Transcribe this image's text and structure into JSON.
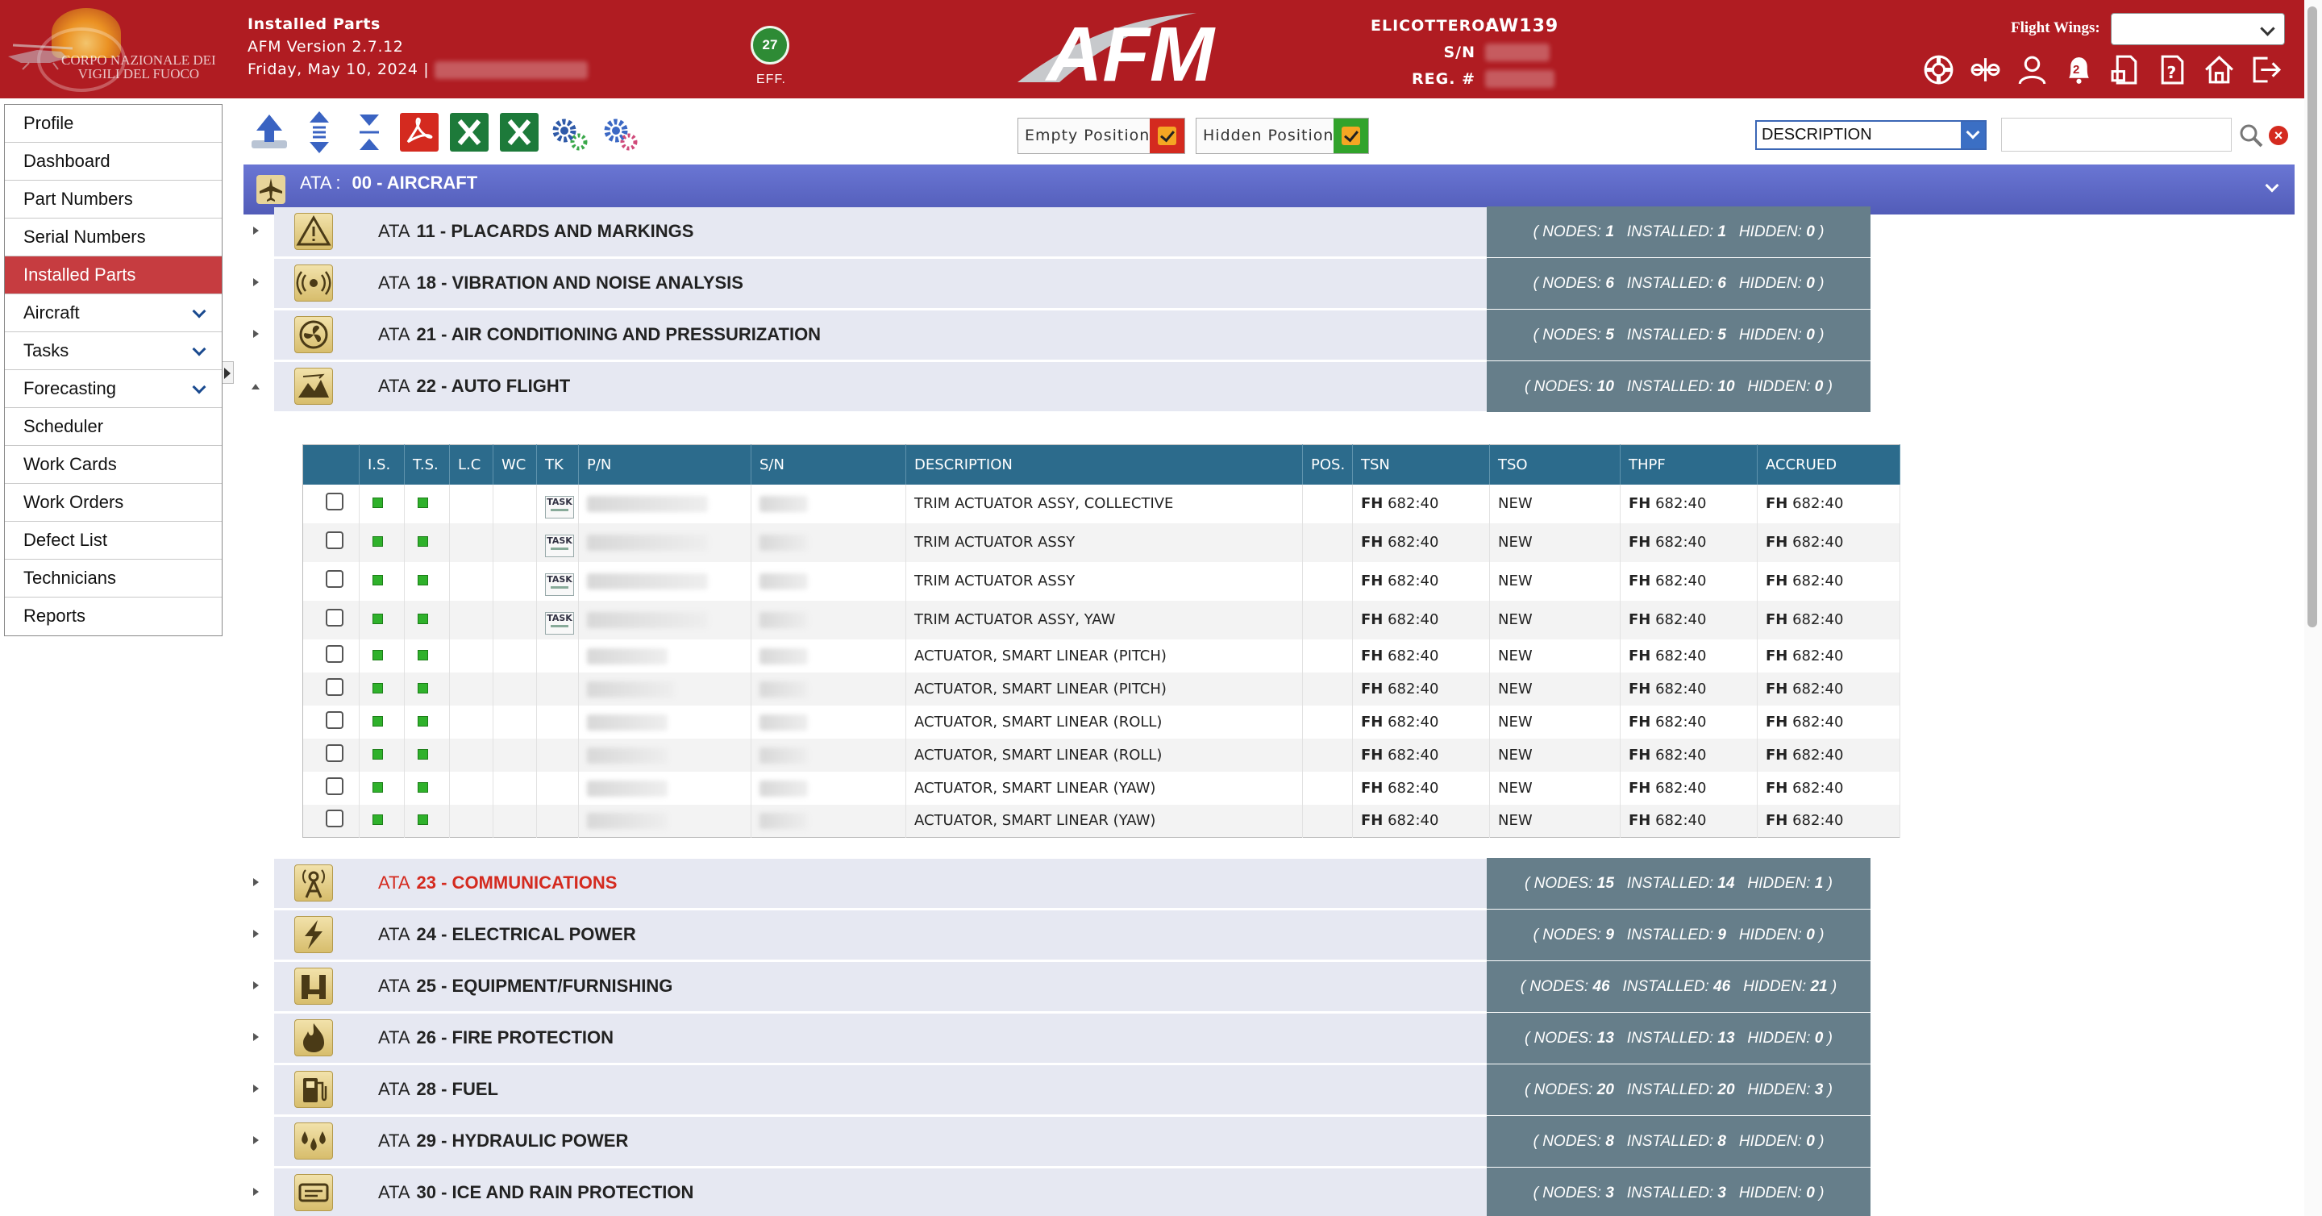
{
  "header": {
    "logo_text": [
      "CORPO NAZIONALE dei",
      "VIGILI DEL FUOCO"
    ],
    "page_title": "Installed Parts",
    "version": "AFM Version 2.7.12",
    "date": "Friday, May 10, 2024 |",
    "eff_count": "27",
    "eff_label": "EFF.",
    "brand": "AFM",
    "heli_label": "ELICOTTERO:",
    "heli_model": "AW139",
    "sn_label": "S/N",
    "reg_label": "REG. #",
    "flight_wings_label": "Flight Wings:",
    "notification_count": "2"
  },
  "sidebar": {
    "items": [
      {
        "label": "Profile",
        "active": false,
        "expandable": false
      },
      {
        "label": "Dashboard",
        "active": false,
        "expandable": false
      },
      {
        "label": "Part Numbers",
        "active": false,
        "expandable": false
      },
      {
        "label": "Serial Numbers",
        "active": false,
        "expandable": false
      },
      {
        "label": "Installed Parts",
        "active": true,
        "expandable": false
      },
      {
        "label": "Aircraft",
        "active": false,
        "expandable": true
      },
      {
        "label": "Tasks",
        "active": false,
        "expandable": true
      },
      {
        "label": "Forecasting",
        "active": false,
        "expandable": true
      },
      {
        "label": "Scheduler",
        "active": false,
        "expandable": false
      },
      {
        "label": "Work Cards",
        "active": false,
        "expandable": false
      },
      {
        "label": "Work Orders",
        "active": false,
        "expandable": false
      },
      {
        "label": "Defect List",
        "active": false,
        "expandable": false
      },
      {
        "label": "Technicians",
        "active": false,
        "expandable": false
      },
      {
        "label": "Reports",
        "active": false,
        "expandable": false
      }
    ]
  },
  "toolbar": {
    "empty_position_label": "Empty Position",
    "hidden_position_label": "Hidden Position",
    "search_field_value": "DESCRIPTION",
    "search_input_value": ""
  },
  "root_ata": {
    "prefix": "ATA :",
    "name": "00 - AIRCRAFT"
  },
  "stats_labels": {
    "nodes": "NODES:",
    "installed": "INSTALLED:",
    "hidden": "HIDDEN:"
  },
  "ata_groups": [
    {
      "code": "11 - PLACARDS AND MARKINGS",
      "icon": "warning-icon",
      "nodes": "1",
      "installed": "1",
      "hidden": "0",
      "expanded": false,
      "alert": false
    },
    {
      "code": "18 - VIBRATION AND NOISE ANALYSIS",
      "icon": "vibration-icon",
      "nodes": "6",
      "installed": "6",
      "hidden": "0",
      "expanded": false,
      "alert": false
    },
    {
      "code": "21 - AIR CONDITIONING AND PRESSURIZATION",
      "icon": "fan-icon",
      "nodes": "5",
      "installed": "5",
      "hidden": "0",
      "expanded": false,
      "alert": false
    },
    {
      "code": "22 - AUTO FLIGHT",
      "icon": "mountain-flight-icon",
      "nodes": "10",
      "installed": "10",
      "hidden": "0",
      "expanded": true,
      "alert": false
    },
    {
      "code": "23 - COMMUNICATIONS",
      "icon": "antenna-icon",
      "nodes": "15",
      "installed": "14",
      "hidden": "1",
      "expanded": false,
      "alert": true
    },
    {
      "code": "24 - ELECTRICAL POWER",
      "icon": "lightning-icon",
      "nodes": "9",
      "installed": "9",
      "hidden": "0",
      "expanded": false,
      "alert": false
    },
    {
      "code": "25 - EQUIPMENT/FURNISHING",
      "icon": "seat-icon",
      "nodes": "46",
      "installed": "46",
      "hidden": "21",
      "expanded": false,
      "alert": false
    },
    {
      "code": "26 - FIRE PROTECTION",
      "icon": "flame-icon",
      "nodes": "13",
      "installed": "13",
      "hidden": "0",
      "expanded": false,
      "alert": false
    },
    {
      "code": "28 - FUEL",
      "icon": "fuel-pump-icon",
      "nodes": "20",
      "installed": "20",
      "hidden": "3",
      "expanded": false,
      "alert": false
    },
    {
      "code": "29 - HYDRAULIC POWER",
      "icon": "drops-icon",
      "nodes": "8",
      "installed": "8",
      "hidden": "0",
      "expanded": false,
      "alert": false
    },
    {
      "code": "30 - ICE AND RAIN PROTECTION",
      "icon": "ice-rain-icon",
      "nodes": "3",
      "installed": "3",
      "hidden": "0",
      "expanded": false,
      "alert": false
    }
  ],
  "ata_word": "ATA",
  "parts_table": {
    "columns": [
      "I.S.",
      "T.S.",
      "L.C",
      "WC",
      "TK",
      "P/N",
      "S/N",
      "DESCRIPTION",
      "POS.",
      "TSN",
      "TSO",
      "THPF",
      "ACCRUED"
    ],
    "task_label": "TASK",
    "rows": [
      {
        "description": "TRIM ACTUATOR ASSY, COLLECTIVE",
        "task": true,
        "tsn": "682:40",
        "tso": "NEW",
        "thpf": "682:40",
        "accrued": "682:40"
      },
      {
        "description": "TRIM ACTUATOR ASSY",
        "task": true,
        "tsn": "682:40",
        "tso": "NEW",
        "thpf": "682:40",
        "accrued": "682:40"
      },
      {
        "description": "TRIM ACTUATOR ASSY",
        "task": true,
        "tsn": "682:40",
        "tso": "NEW",
        "thpf": "682:40",
        "accrued": "682:40"
      },
      {
        "description": "TRIM ACTUATOR ASSY, YAW",
        "task": true,
        "tsn": "682:40",
        "tso": "NEW",
        "thpf": "682:40",
        "accrued": "682:40"
      },
      {
        "description": "ACTUATOR, SMART LINEAR (PITCH)",
        "task": false,
        "tsn": "682:40",
        "tso": "NEW",
        "thpf": "682:40",
        "accrued": "682:40"
      },
      {
        "description": "ACTUATOR, SMART LINEAR (PITCH)",
        "task": false,
        "tsn": "682:40",
        "tso": "NEW",
        "thpf": "682:40",
        "accrued": "682:40"
      },
      {
        "description": "ACTUATOR, SMART LINEAR (ROLL)",
        "task": false,
        "tsn": "682:40",
        "tso": "NEW",
        "thpf": "682:40",
        "accrued": "682:40"
      },
      {
        "description": "ACTUATOR, SMART LINEAR (ROLL)",
        "task": false,
        "tsn": "682:40",
        "tso": "NEW",
        "thpf": "682:40",
        "accrued": "682:40"
      },
      {
        "description": "ACTUATOR, SMART LINEAR (YAW)",
        "task": false,
        "tsn": "682:40",
        "tso": "NEW",
        "thpf": "682:40",
        "accrued": "682:40"
      },
      {
        "description": "ACTUATOR, SMART LINEAR (YAW)",
        "task": false,
        "tsn": "682:40",
        "tso": "NEW",
        "thpf": "682:40",
        "accrued": "682:40"
      }
    ],
    "fh_label": "FH"
  },
  "colors": {
    "header_red": "#b01c22",
    "ata_bar": "#5a64c2",
    "stats_bg": "#667e8a",
    "table_header": "#2c6b8c",
    "status_green": "#2fb12b",
    "alert_red": "#d42a1f"
  }
}
